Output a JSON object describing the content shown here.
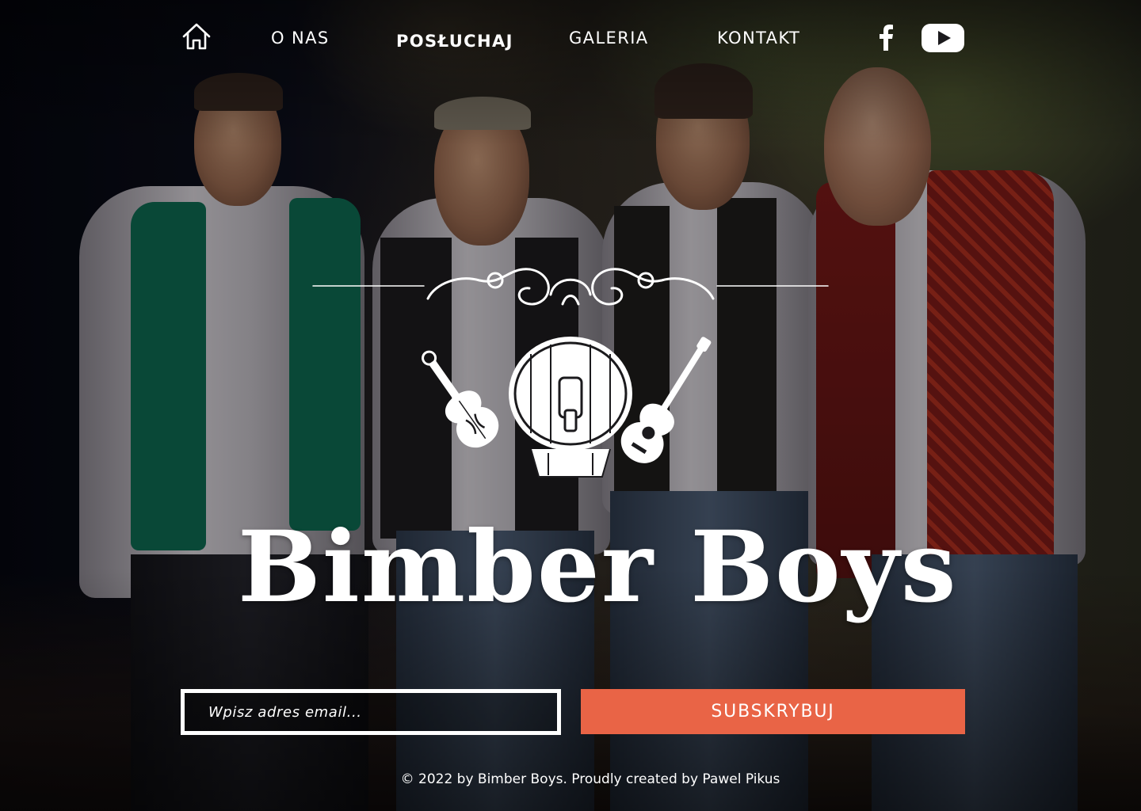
{
  "nav": {
    "home_icon": "home-icon",
    "links": [
      {
        "label": "O NAS"
      },
      {
        "label": "POSŁUCHAJ"
      },
      {
        "label": "GALERIA"
      },
      {
        "label": "KONTAKT"
      }
    ],
    "social": [
      {
        "icon": "facebook-icon"
      },
      {
        "icon": "youtube-icon"
      }
    ]
  },
  "hero": {
    "band_name": "Bimber Boys",
    "logo_icons": [
      "flourish-ornament",
      "violin-icon",
      "barrel-icon",
      "guitar-icon"
    ]
  },
  "subscribe": {
    "placeholder": "Wpisz adres email...",
    "button_label": "SUBSKRYBUJ"
  },
  "footer": {
    "copyright": "© 2022 by Bimber Boys. Proudly created by Pawel Pikus"
  },
  "colors": {
    "accent": "#e96446",
    "text": "#ffffff"
  }
}
